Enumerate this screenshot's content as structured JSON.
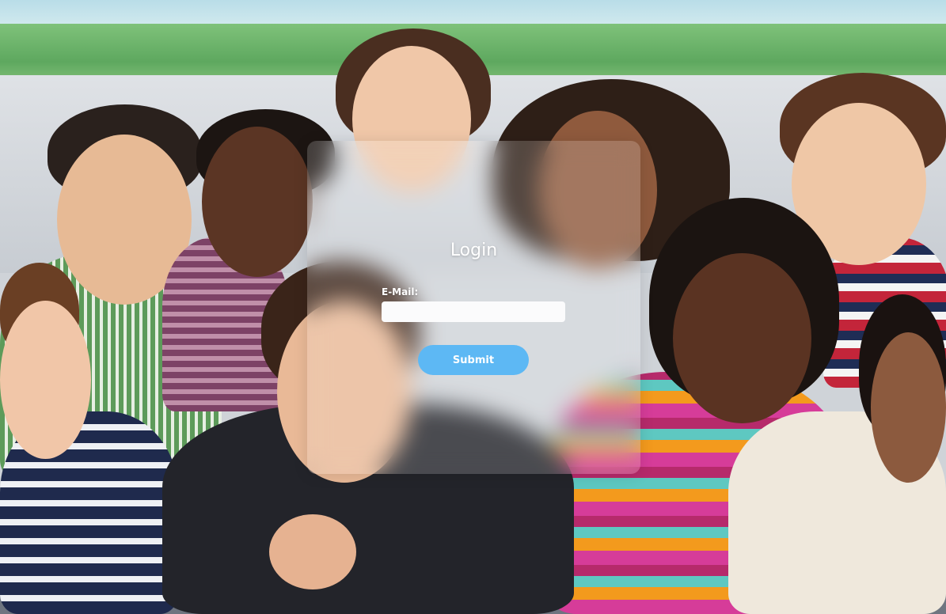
{
  "login": {
    "title": "Login",
    "email_label": "E-Mail:",
    "email_value": "",
    "email_placeholder": "",
    "submit_label": "Submit"
  },
  "colors": {
    "submit_button": "#5db8f4",
    "panel_text": "#ffffff",
    "input_background": "#fbfbfc"
  }
}
